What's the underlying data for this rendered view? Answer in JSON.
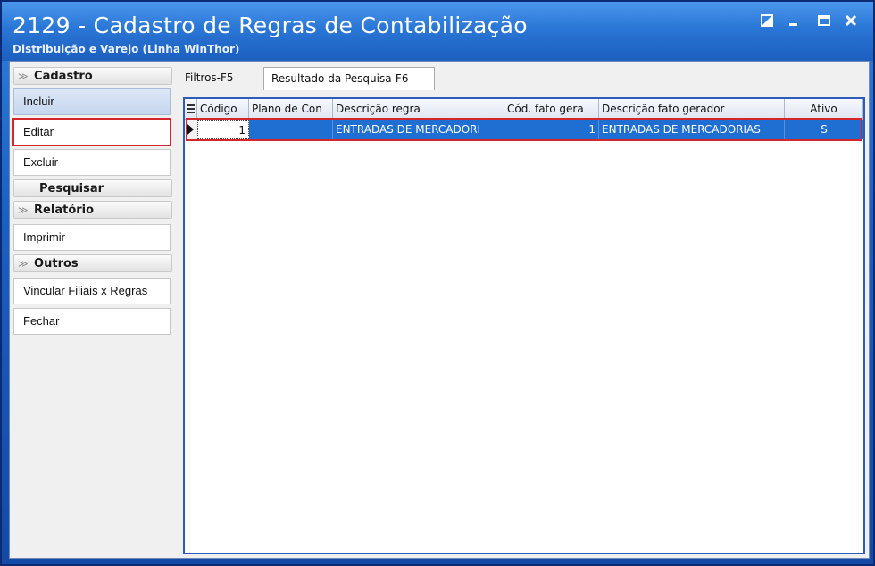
{
  "window": {
    "title": "2129 - Cadastro de Regras de Contabilização",
    "subtitle": "Distribuição e Varejo (Linha WinThor)"
  },
  "sidebar": {
    "groups": [
      {
        "label": "Cadastro",
        "items": [
          "Incluir",
          "Editar",
          "Excluir"
        ]
      },
      {
        "label": "Pesquisar",
        "items": []
      },
      {
        "label": "Relatório",
        "items": [
          "Imprimir"
        ]
      },
      {
        "label": "Outros",
        "items": [
          "Vincular Filiais x Regras",
          "Fechar"
        ]
      }
    ]
  },
  "tabs": {
    "filters": "Filtros-F5",
    "results": "Resultado da Pesquisa-F6"
  },
  "grid": {
    "columns": [
      "Código",
      "Plano de Con",
      "Descrição regra",
      "Cód. fato gera",
      "Descrição fato gerador",
      "Ativo"
    ],
    "rows": [
      {
        "codigo": "1",
        "plano": "",
        "descricao_regra": "ENTRADAS DE MERCADORI",
        "cod_fato": "1",
        "descricao_fato": "ENTRADAS DE MERCADORIAS",
        "ativo": "S"
      }
    ]
  },
  "colors": {
    "title_bar": "#2a76d6",
    "selected_row": "#1f6fd2",
    "highlight_box": "#d6262d"
  }
}
